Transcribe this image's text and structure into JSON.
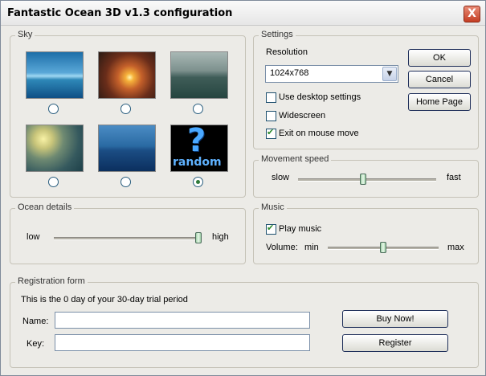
{
  "window": {
    "title": "Fantastic Ocean 3D v1.3 configuration",
    "close_symbol": "X"
  },
  "sky": {
    "legend": "Sky",
    "options": [
      {
        "name": "sky-option-1",
        "selected": false
      },
      {
        "name": "sky-option-2",
        "selected": false
      },
      {
        "name": "sky-option-3",
        "selected": false
      },
      {
        "name": "sky-option-4",
        "selected": false
      },
      {
        "name": "sky-option-5",
        "selected": false
      },
      {
        "name": "sky-option-random",
        "selected": true,
        "label": "random",
        "mark": "?"
      }
    ]
  },
  "settings": {
    "legend": "Settings",
    "resolution_label": "Resolution",
    "resolution_value": "1024x768",
    "use_desktop": {
      "label": "Use desktop settings",
      "checked": false
    },
    "widescreen": {
      "label": "Widescreen",
      "checked": false
    },
    "exit_on_mouse": {
      "label": "Exit on mouse move",
      "checked": true
    }
  },
  "buttons": {
    "ok": "OK",
    "cancel": "Cancel",
    "home": "Home Page",
    "buy": "Buy Now!",
    "register": "Register"
  },
  "movement": {
    "legend": "Movement speed",
    "min": "slow",
    "max": "fast",
    "value": 0.47
  },
  "ocean": {
    "legend": "Ocean details",
    "min": "low",
    "max": "high",
    "value": 1.0
  },
  "music": {
    "legend": "Music",
    "play": {
      "label": "Play music",
      "checked": true
    },
    "volume_label": "Volume:",
    "min": "min",
    "max": "max",
    "value": 0.5
  },
  "registration": {
    "legend": "Registration form",
    "trial_text": "This is the 0 day of your 30-day trial period",
    "name_label": "Name:",
    "key_label": "Key:",
    "name_value": "",
    "key_value": ""
  }
}
